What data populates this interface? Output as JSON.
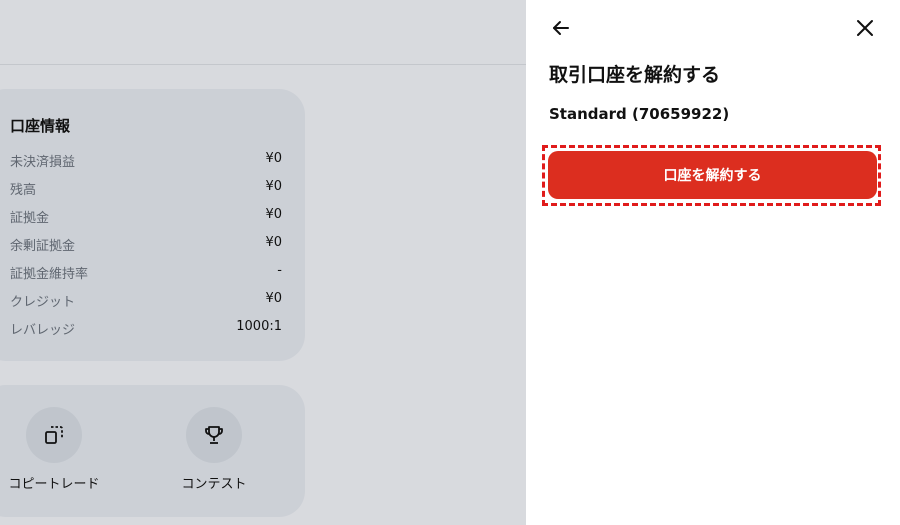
{
  "account_info": {
    "title": "口座情報",
    "rows": [
      {
        "label": "未決済損益",
        "value": "¥0"
      },
      {
        "label": "残高",
        "value": "¥0"
      },
      {
        "label": "証拠金",
        "value": "¥0"
      },
      {
        "label": "余剰証拠金",
        "value": "¥0"
      },
      {
        "label": "証拠金維持率",
        "value": "-"
      },
      {
        "label": "クレジット",
        "value": "¥0"
      },
      {
        "label": "レバレッジ",
        "value": "1000:1"
      }
    ]
  },
  "actions": [
    {
      "label": "コピートレード",
      "icon": "copy-icon"
    },
    {
      "label": "コンテスト",
      "icon": "trophy-icon"
    }
  ],
  "panel": {
    "title": "取引口座を解約する",
    "account_name": "Standard (70659922)",
    "close_button_label": "口座を解約する",
    "back_icon": "arrow-left-icon",
    "close_icon": "close-icon"
  },
  "colors": {
    "primary_button": "#dc2e1f",
    "highlight_border": "#e01b1b",
    "overlay_background": "#d8dade"
  }
}
